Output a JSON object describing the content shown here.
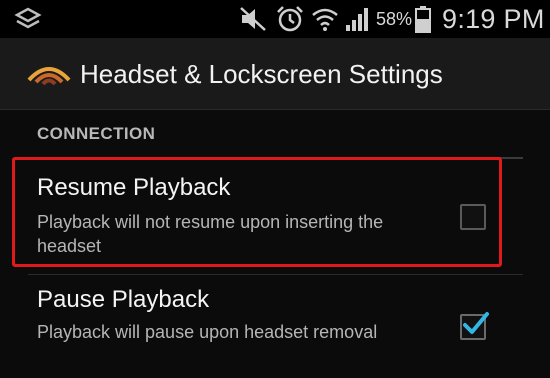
{
  "status_bar": {
    "battery_percent": "58%",
    "time": "9:19 PM"
  },
  "action_bar": {
    "title": "Headset & Lockscreen Settings"
  },
  "section": {
    "header": "CONNECTION"
  },
  "preferences": [
    {
      "title": "Resume Playback",
      "summary": "Playback will not resume upon inserting the headset",
      "checked": false
    },
    {
      "title": "Pause Playback",
      "summary": "Playback will pause upon headset removal",
      "checked": true
    }
  ],
  "colors": {
    "highlight": "#e01a1a",
    "check_accent": "#33b5e5"
  }
}
